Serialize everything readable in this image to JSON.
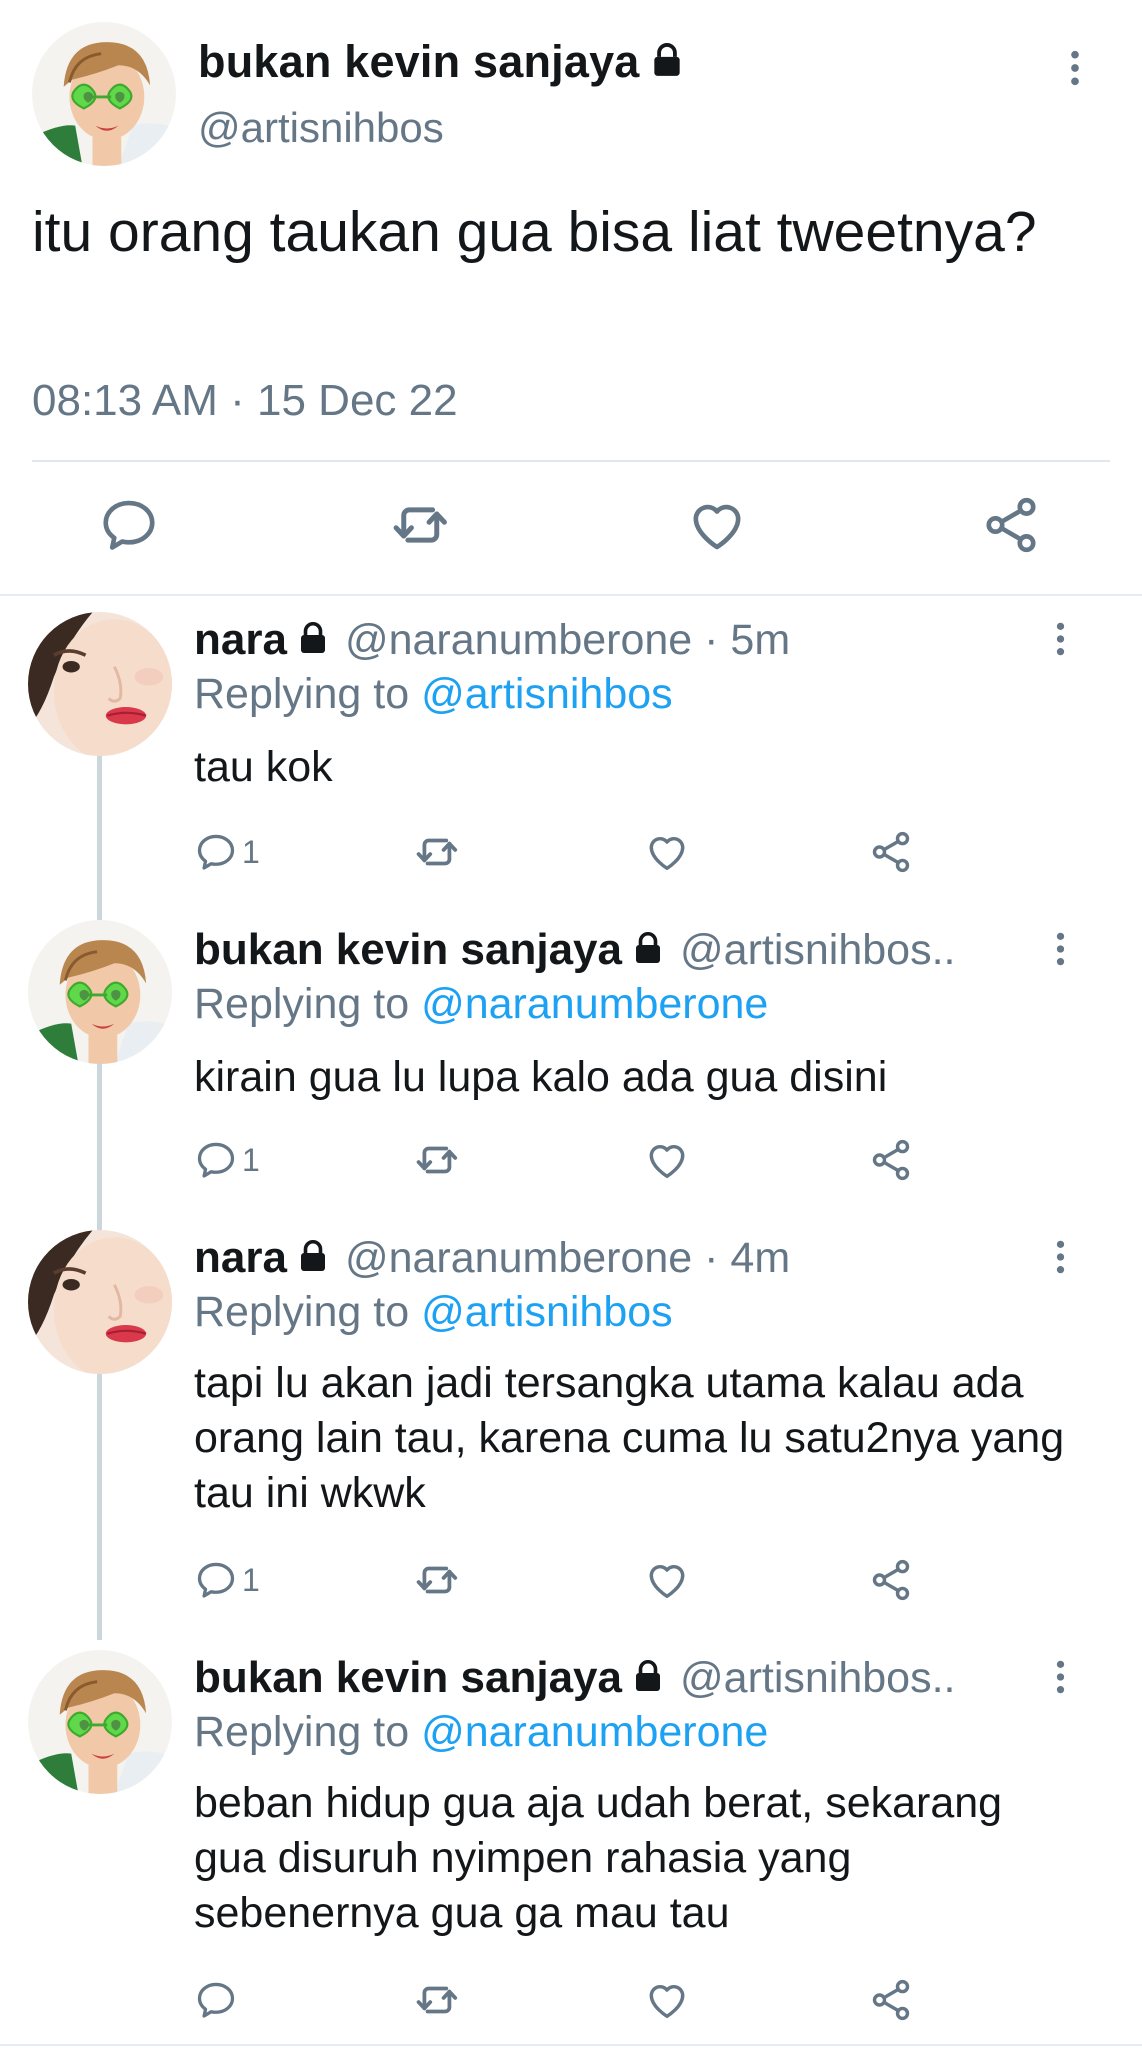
{
  "main_tweet": {
    "display_name": "bukan kevin sanjaya",
    "handle": "@artisnihbos",
    "text": "itu orang taukan gua bisa liat tweetnya?",
    "timestamp": "08:13 AM · 15 Dec 22",
    "actions": [
      "reply-icon",
      "retweet-icon",
      "like-icon",
      "share-icon"
    ]
  },
  "replies": [
    {
      "display_name": "nara",
      "handle": "@naranumberone · 5m",
      "replying_prefix": "Replying to ",
      "replying_to": "@artisnihbos",
      "text": "tau kok",
      "reply_count": "1"
    },
    {
      "display_name": "bukan kevin sanjaya",
      "handle": "@artisnihbos..",
      "replying_prefix": "Replying to ",
      "replying_to": "@naranumberone",
      "text": "kirain gua lu lupa kalo ada gua disini",
      "reply_count": "1"
    },
    {
      "display_name": "nara",
      "handle": "@naranumberone · 4m",
      "replying_prefix": "Replying to ",
      "replying_to": "@artisnihbos",
      "text": "tapi lu akan jadi tersangka utama kalau ada orang lain tau, karena cuma lu satu2nya yang tau ini wkwk",
      "reply_count": "1"
    },
    {
      "display_name": "bukan kevin sanjaya",
      "handle": "@artisnihbos..",
      "replying_prefix": "Replying to ",
      "replying_to": "@naranumberone",
      "text": "beban hidup gua aja udah berat, sekarang gua disuruh nyimpen rahasia yang sebenernya gua ga mau tau",
      "reply_count": ""
    }
  ],
  "colors": {
    "text": "#14171a",
    "secondary": "#657786",
    "link": "#1da1f2",
    "divider": "#e1e8ed",
    "icon": "#657786"
  }
}
